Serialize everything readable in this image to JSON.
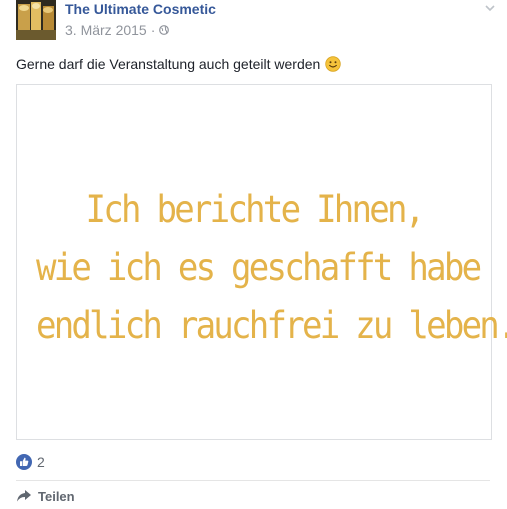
{
  "post": {
    "author": "The Ultimate Cosmetic",
    "date": "3. März 2015",
    "separator": "·",
    "audience_icon": "globe-icon",
    "text": "Gerne darf die Veranstaltung auch geteilt werden",
    "emoji": "smiley-icon",
    "menu_icon": "chevron-down-icon"
  },
  "image": {
    "lines": [
      "Ich berichte Ihnen,",
      "wie ich es geschafft habe",
      "endlich rauchfrei zu leben."
    ],
    "text_color": "#e4b34a"
  },
  "reactions": {
    "icon": "like-icon",
    "count": "2",
    "color": "#4267b2"
  },
  "actions": {
    "share_label": "Teilen",
    "share_icon": "share-icon"
  },
  "colors": {
    "link": "#365899",
    "meta": "#90949c"
  }
}
